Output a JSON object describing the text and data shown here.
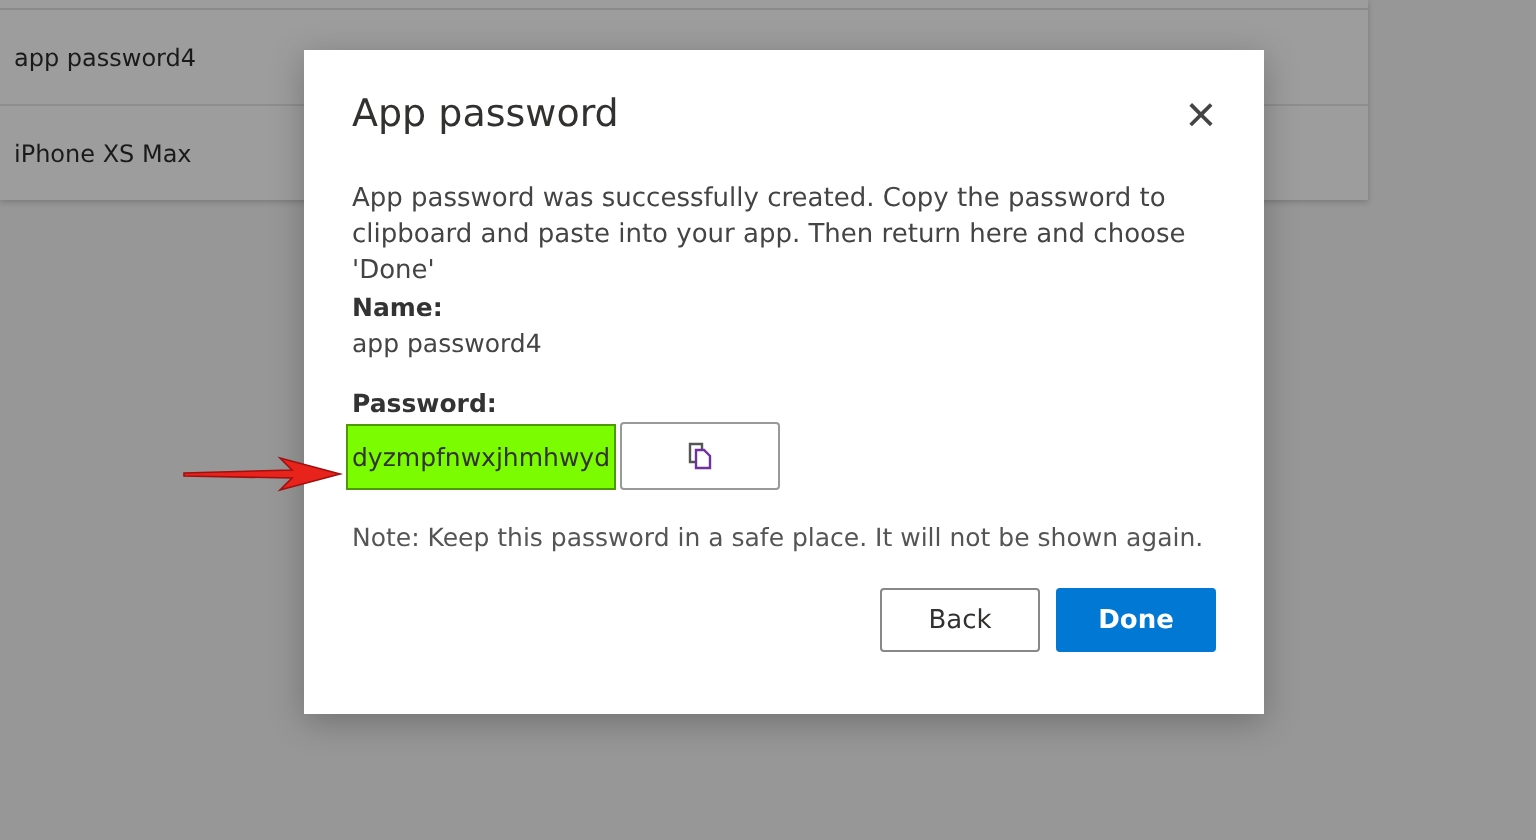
{
  "list": {
    "rows": [
      "app password4",
      "iPhone XS Max"
    ]
  },
  "dialog": {
    "title": "App password",
    "close": "×",
    "message": "App password was successfully created. Copy the password to clipboard and paste into your app. Then return here and choose 'Done'",
    "name_label": "Name:",
    "name_value": "app password4",
    "password_label": "Password:",
    "password_value": "dyzmpfnwxjhmhwyd",
    "highlighted": true,
    "note": "Note: Keep this password in a safe place. It will not be shown again.",
    "buttons": [
      {
        "label": "Back",
        "kind": "secondary"
      },
      {
        "label": "Done",
        "kind": "primary"
      }
    ]
  }
}
